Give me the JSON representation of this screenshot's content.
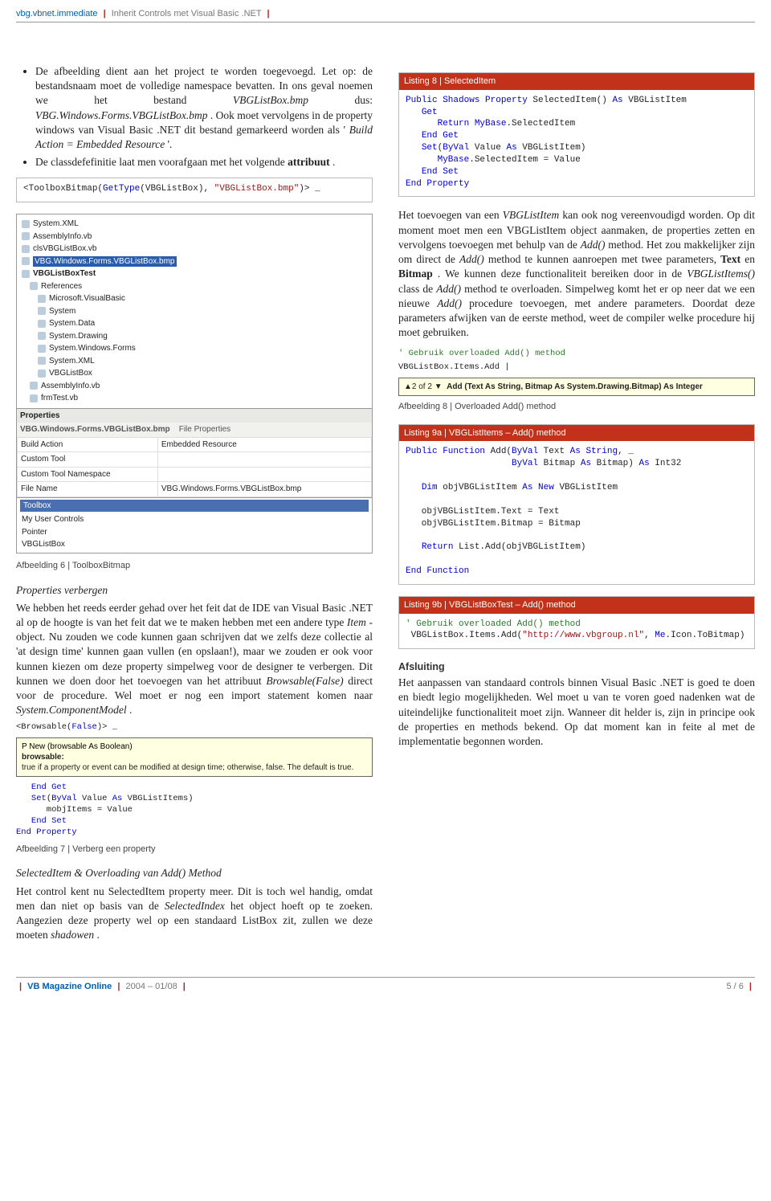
{
  "header": {
    "brand": "vbg.vbnet.immediate",
    "title": "Inherit Controls met Visual Basic .NET"
  },
  "bullets": {
    "b1_pre": "De afbeelding dient aan het project te worden toegevoegd. Let op: de bestandsnaam moet de volledige namespace bevatten. In ons geval noemen we het bestand ",
    "b1_it1": "VBGListBox.bmp",
    "b1_mid1": " dus: ",
    "b1_it2": "VBG.Windows.Forms.VBGListBox.bmp",
    "b1_mid2": ". Ook moet vervolgens in de property windows van Visual Basic .NET dit bestand gemarkeerd worden als '",
    "b1_it3": "Build Action = Embedded Resource",
    "b1_end": "'.",
    "b2_pre": "De classdefefinitie laat men voorafgaan met het volgende ",
    "b2_bold": "attribuut",
    "b2_end": "."
  },
  "snippet_tbbmp": {
    "line": "<ToolboxBitmap(GetType(VBGListBox), \"VBGListBox.bmp\")> _"
  },
  "afb6": {
    "tree": [
      "System.XML",
      "AssemblyInfo.vb",
      "clsVBGListBox.vb"
    ],
    "tree_selected": "VBG.Windows.Forms.VBGListBox.bmp",
    "tree_project": "VBGListBoxTest",
    "tree_refs": [
      "References",
      "Microsoft.VisualBasic",
      "System",
      "System.Data",
      "System.Drawing",
      "System.Windows.Forms",
      "System.XML",
      "VBGListBox"
    ],
    "tree_tail": [
      "AssemblyInfo.vb",
      "frmTest.vb"
    ],
    "propgrid": {
      "title": "Properties",
      "subtitle_file": "VBG.Windows.Forms.VBGListBox.bmp",
      "subtitle_kind": "File Properties",
      "rows": [
        [
          "Build Action",
          "Embedded Resource"
        ],
        [
          "Custom Tool",
          ""
        ],
        [
          "Custom Tool Namespace",
          ""
        ],
        [
          "File Name",
          "VBG.Windows.Forms.VBGListBox.bmp"
        ]
      ]
    },
    "toolbox": {
      "title": "Toolbox",
      "items": [
        "My User Controls",
        "Pointer",
        "VBGListBox"
      ]
    }
  },
  "caption6": "Afbeelding 6 | ToolboxBitmap",
  "sec_propverb": {
    "title": "Properties verbergen",
    "body_pre": "We hebben het reeds eerder gehad over het feit dat de IDE van Visual Basic .NET al op de hoogte is van het feit dat we te maken hebben met een andere type ",
    "body_it1": "Item",
    "body_mid1": "-object. Nu zouden we code kunnen gaan schrijven dat we zelfs deze collectie al 'at design time' kunnen gaan vullen (en opslaan!), maar we zouden er ook voor kunnen kiezen om deze property simpelweg voor de designer te verbergen. Dit kunnen we doen door het toevoegen van het attribuut ",
    "body_it2": "Browsable(False)",
    "body_mid2": " direct voor de procedure. Wel moet er nog een import statement komen naar ",
    "body_it3": "System.ComponentModel",
    "body_end": "."
  },
  "afb7": {
    "attr_line": "<Browsable(False)> _",
    "prop_line": "P New (browsable As Boolean)",
    "tip_name": "browsable:",
    "tip_body": "true if a property or event can be modified at design time; otherwise, false. The default is true.",
    "code_lines": [
      "   End Get",
      "   Set(ByVal Value As VBGListItems)",
      "      mobjItems = Value",
      "   End Set",
      "End Property"
    ]
  },
  "caption7": "Afbeelding 7 | Verberg een property",
  "sec_selitem": {
    "title": "SelectedItem & Overloading van Add() Method",
    "body_pre": "Het control kent nu SelectedItem property meer. Dit is toch wel handig, omdat men dan niet op basis van de ",
    "body_it1": "SelectedIndex",
    "body_mid1": " het object hoeft op te zoeken. Aangezien deze property wel op een standaard ListBox zit, zullen we deze moeten ",
    "body_it2": "shadowen",
    "body_end": "."
  },
  "listing8": {
    "header": "Listing 8 | SelectedItem",
    "lines": [
      "Public Shadows Property SelectedItem() As VBGListItem",
      "   Get",
      "      Return MyBase.SelectedItem",
      "   End Get",
      "   Set(ByVal Value As VBGListItem)",
      "      MyBase.SelectedItem = Value",
      "   End Set",
      "End Property"
    ]
  },
  "para_add": {
    "pre": "Het toevoegen van een ",
    "it1": "VBGListItem",
    "mid1": " kan ook nog vereenvoudigd worden. Op dit moment moet men een VBGListItem object aanmaken, de properties zetten en vervolgens toevoegen met behulp van de ",
    "it2": "Add()",
    "mid2": " method. Het zou makkelijker zijn om direct de ",
    "it3": "Add()",
    "mid3": " method te kunnen aanroepen met twee parameters, ",
    "b1": "Text",
    "mid4": " en ",
    "b2": "Bitmap",
    "mid5": ". We kunnen deze functionaliteit bereiken door in de ",
    "it4": "VBGListItems()",
    "mid6": " class de ",
    "it5": "Add()",
    "mid7": " method te overloaden. Simpelweg komt het er op neer dat we een nieuwe ",
    "it6": "Add()",
    "mid8": " procedure toevoegen, met andere parameters. Doordat deze parameters afwijken van de eerste method, weet de compiler welke procedure hij moet gebruiken."
  },
  "afb8": {
    "cmt": "' Gebruik overloaded Add() method",
    "line": "VBGListBox.Items.Add",
    "counter": "▲2 of 2 ▼",
    "sig": "Add (Text As String, Bitmap As System.Drawing.Bitmap) As Integer"
  },
  "caption8": "Afbeelding 8 | Overloaded Add() method",
  "listing9a": {
    "header": "Listing 9a | VBGListItems – Add() method",
    "lines": [
      "Public Function Add(ByVal Text As String, _",
      "                    ByVal Bitmap As Bitmap) As Int32",
      "",
      "   Dim objVBGListItem As New VBGListItem",
      "",
      "   objVBGListItem.Text = Text",
      "   objVBGListItem.Bitmap = Bitmap",
      "",
      "   Return List.Add(objVBGListItem)",
      "",
      "End Function"
    ]
  },
  "listing9b": {
    "header": "Listing 9b | VBGListBoxTest – Add() method",
    "cmt": "' Gebruik overloaded Add() method",
    "line": " VBGListBox.Items.Add(\"http://www.vbgroup.nl\", Me.Icon.ToBitmap)"
  },
  "afsluiting": {
    "title": "Afsluiting",
    "body": "Het aanpassen van standaard controls binnen Visual Basic .NET is goed te doen en biedt legio mogelijkheden. Wel moet u van te voren goed nadenken wat de uiteindelijke functionaliteit moet zijn. Wanneer dit helder is, zijn in principe ook de properties en methods bekend. Op dat moment kan in feite al met de implementatie begonnen worden."
  },
  "footer": {
    "mag": "VB Magazine Online",
    "issue": "2004 – 01/08",
    "page": "5 / 6"
  }
}
